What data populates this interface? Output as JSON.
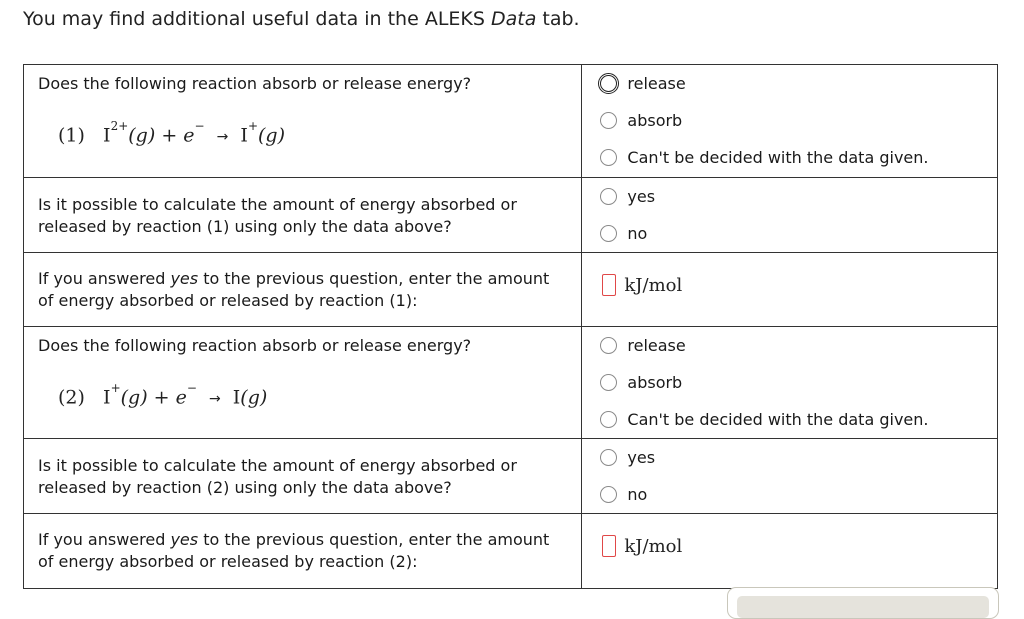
{
  "intro": {
    "prefix": "You may find additional useful data in the ALEKS ",
    "italic": "Data",
    "suffix": " tab."
  },
  "rows": {
    "r1": {
      "question": "Does the following reaction absorb or release energy?",
      "eq": {
        "num": "(1)",
        "reactant": "I",
        "reactant_charge": "2+",
        "state1": "(g)",
        "plus": "+",
        "electron": "e",
        "electron_charge": "−",
        "arrow": "→",
        "product": "I",
        "product_charge": "+",
        "state2": "(g)"
      },
      "options": [
        "release",
        "absorb",
        "Can't be decided with the data given."
      ]
    },
    "r2": {
      "question": "Is it possible to calculate the amount of energy absorbed or released by reaction (1) using only the data above?",
      "options": [
        "yes",
        "no"
      ]
    },
    "r3": {
      "q_prefix": "If you answered ",
      "q_italic": "yes",
      "q_suffix": " to the previous question, enter the amount of energy absorbed or released by reaction (1):",
      "unit": "kJ/mol",
      "value": ""
    },
    "r4": {
      "question": "Does the following reaction absorb or release energy?",
      "eq": {
        "num": "(2)",
        "reactant": "I",
        "reactant_charge": "+",
        "state1": "(g)",
        "plus": "+",
        "electron": "e",
        "electron_charge": "−",
        "arrow": "→",
        "product": "I",
        "product_charge": "",
        "state2": "(g)"
      },
      "options": [
        "release",
        "absorb",
        "Can't be decided with the data given."
      ]
    },
    "r5": {
      "question": "Is it possible to calculate the amount of energy absorbed or released by reaction (2) using only the data above?",
      "options": [
        "yes",
        "no"
      ]
    },
    "r6": {
      "q_prefix": "If you answered ",
      "q_italic": "yes",
      "q_suffix": " to the previous question, enter the amount of energy absorbed or released by reaction (2):",
      "unit": "kJ/mol",
      "value": ""
    }
  }
}
